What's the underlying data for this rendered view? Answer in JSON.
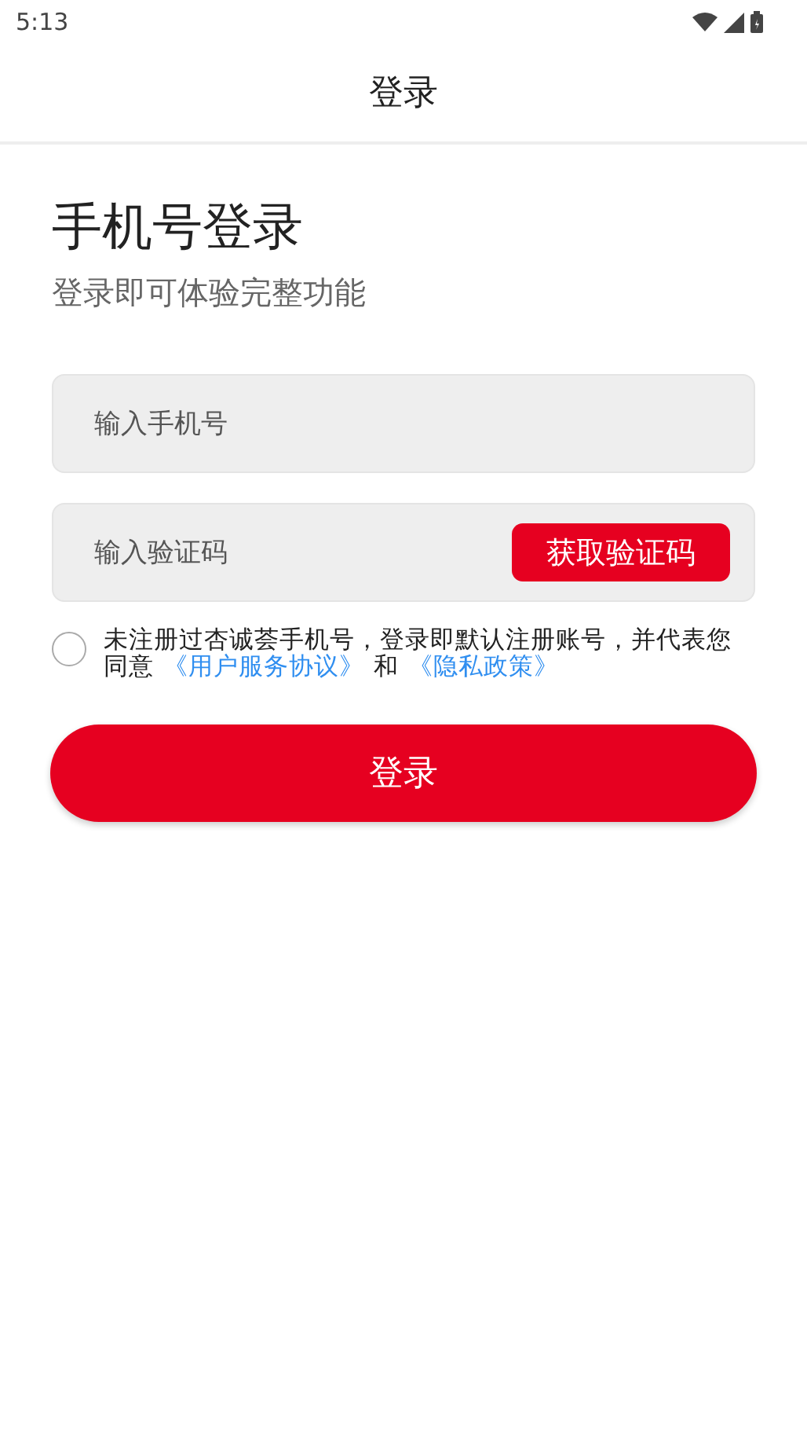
{
  "status_bar": {
    "time": "5:13"
  },
  "header": {
    "title": "登录"
  },
  "heading": "手机号登录",
  "subtitle": "登录即可体验完整功能",
  "phone_field": {
    "placeholder": "输入手机号"
  },
  "code_field": {
    "placeholder": "输入验证码",
    "button": "获取验证码"
  },
  "agreement": {
    "checked": false,
    "text": "未注册过杏诚荟手机号，登录即默认注册账号，并代表您同意",
    "links": [
      "《用户服务协议》",
      "《隐私政策》"
    ],
    "conjunction": "和"
  },
  "login_button": "登录"
}
